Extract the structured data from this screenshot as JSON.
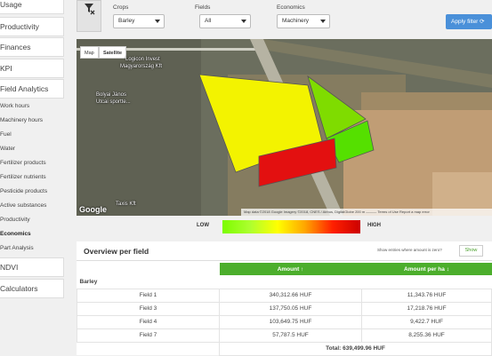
{
  "sidebar": {
    "items": [
      {
        "label": "Usage",
        "type": "nav"
      },
      {
        "label": "Productivity",
        "type": "nav"
      },
      {
        "label": "Finances",
        "type": "nav"
      },
      {
        "label": "KPI",
        "type": "nav"
      },
      {
        "label": "Field Analytics",
        "type": "nav"
      }
    ],
    "subitems": [
      {
        "label": "Work hours"
      },
      {
        "label": "Machinery hours"
      },
      {
        "label": "Fuel"
      },
      {
        "label": "Water"
      },
      {
        "label": "Fertilizer products"
      },
      {
        "label": "Fertilizer nutrients"
      },
      {
        "label": "Pesticide products"
      },
      {
        "label": "Active substances"
      },
      {
        "label": "Productivity"
      },
      {
        "label": "Economics",
        "active": true
      },
      {
        "label": "Part Analysis"
      }
    ],
    "bottom": [
      {
        "label": "NDVI"
      },
      {
        "label": "Calculators"
      }
    ]
  },
  "filters": {
    "crops": {
      "label": "Crops",
      "value": "Barley"
    },
    "fields": {
      "label": "Fields",
      "value": "All"
    },
    "economics": {
      "label": "Economics",
      "value": "Machinery"
    },
    "apply": "Apply filter ⟳"
  },
  "map": {
    "type_map": "Map",
    "type_satellite": "Satellite",
    "labels": [
      {
        "text": "Logicon Invest"
      },
      {
        "text": "Magyarország Kft"
      },
      {
        "text": "Bolyai János"
      },
      {
        "text": "Utcai sportte..."
      },
      {
        "text": "Taxis Kft"
      }
    ],
    "google": "Google",
    "footer": "Map data ©2018 Google Imagery ©2018, CNES / Airbus, DigitalGlobe   200 m ———   Terms of Use   Report a map error",
    "field_colors": {
      "field1": "#f3f300",
      "field3": "#7fdc00",
      "field4": "#55e000",
      "field7": "#e31010"
    }
  },
  "scale": {
    "low": "LOW",
    "high": "HIGH"
  },
  "overview": {
    "title": "Overview per field",
    "zero_q": "Show entries where amount is zero?",
    "show_btn": "Show",
    "col_amount": "Amount ↑",
    "col_per_ha": "Amount per ha ↕",
    "group": "Barley",
    "rows": [
      {
        "field": "Field 1",
        "amount": "340,312.66 HUF",
        "per_ha": "11,343.76 HUF"
      },
      {
        "field": "Field 3",
        "amount": "137,750.05 HUF",
        "per_ha": "17,218.76 HUF"
      },
      {
        "field": "Field 4",
        "amount": "103,649.75 HUF",
        "per_ha": "9,422.7 HUF"
      },
      {
        "field": "Field 7",
        "amount": "57,787.5 HUF",
        "per_ha": "8,255.36 HUF"
      }
    ],
    "total": "Total: 639,499.96 HUF"
  }
}
